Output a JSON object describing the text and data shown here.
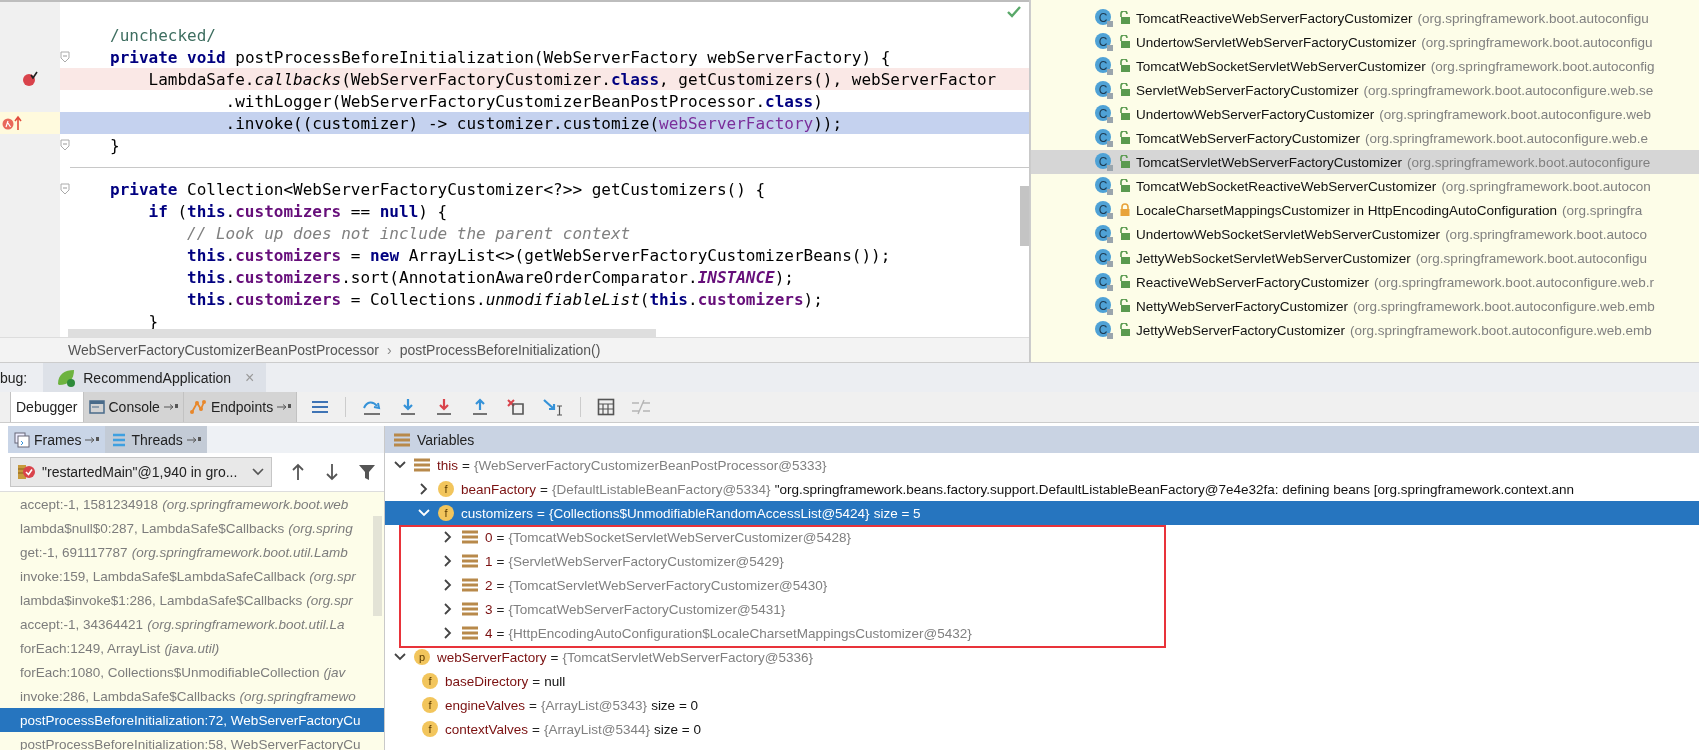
{
  "editor": {
    "lines": [
      {
        "breakpoint": false,
        "execution": false,
        "fold": false,
        "tokens": [
          {
            "kind": "annotation",
            "text": "/unchecked/"
          }
        ]
      },
      {
        "breakpoint": false,
        "execution": false,
        "fold": true,
        "tokens": [
          {
            "kind": "kw",
            "text": "private"
          },
          {
            "kind": "kw",
            "text": " void"
          },
          {
            "kind": "plain",
            "text": " postProcessBeforeInitialization(WebServerFactory webServerFactory) {"
          }
        ]
      },
      {
        "breakpoint": true,
        "execution": false,
        "fold": false,
        "tokens": [
          {
            "kind": "plain",
            "text": "    LambdaSafe."
          },
          {
            "kind": "italic",
            "text": "callbacks"
          },
          {
            "kind": "plain",
            "text": "(WebServerFactoryCustomizer."
          },
          {
            "kind": "kw",
            "text": "class"
          },
          {
            "kind": "plain",
            "text": ", getCustomizers(), webServerFactor"
          }
        ]
      },
      {
        "breakpoint": false,
        "execution": false,
        "fold": false,
        "tokens": [
          {
            "kind": "plain",
            "text": "            .withLogger(WebServerFactoryCustomizerBeanPostProcessor."
          },
          {
            "kind": "kw",
            "text": "class"
          },
          {
            "kind": "plain",
            "text": ")"
          }
        ]
      },
      {
        "breakpoint": false,
        "execution": true,
        "fold": false,
        "tokens": [
          {
            "kind": "plain",
            "text": "            .invoke((customizer) -> customizer.customize("
          },
          {
            "kind": "param",
            "text": "webServerFactory"
          },
          {
            "kind": "plain",
            "text": "));"
          }
        ]
      },
      {
        "breakpoint": false,
        "execution": false,
        "fold": true,
        "tokens": [
          {
            "kind": "plain",
            "text": "}"
          }
        ]
      },
      {
        "kind": "separator"
      },
      {
        "breakpoint": false,
        "execution": false,
        "fold": true,
        "tokens": [
          {
            "kind": "kw",
            "text": "private"
          },
          {
            "kind": "plain",
            "text": " Collection<WebServerFactoryCustomizer<?>> getCustomizers() {"
          }
        ]
      },
      {
        "breakpoint": false,
        "execution": false,
        "fold": false,
        "tokens": [
          {
            "kind": "kw",
            "text": "    if"
          },
          {
            "kind": "plain",
            "text": " ("
          },
          {
            "kind": "kw",
            "text": "this"
          },
          {
            "kind": "plain",
            "text": "."
          },
          {
            "kind": "field",
            "text": "customizers"
          },
          {
            "kind": "plain",
            "text": " == "
          },
          {
            "kind": "kw",
            "text": "null"
          },
          {
            "kind": "plain",
            "text": ") {"
          }
        ]
      },
      {
        "breakpoint": false,
        "execution": false,
        "fold": false,
        "tokens": [
          {
            "kind": "comment",
            "text": "        // Look up does not include the parent context"
          }
        ]
      },
      {
        "breakpoint": false,
        "execution": false,
        "fold": false,
        "tokens": [
          {
            "kind": "kw",
            "text": "        this"
          },
          {
            "kind": "plain",
            "text": "."
          },
          {
            "kind": "field",
            "text": "customizers"
          },
          {
            "kind": "plain",
            "text": " = "
          },
          {
            "kind": "kw",
            "text": "new"
          },
          {
            "kind": "plain",
            "text": " ArrayList<>(getWebServerFactoryCustomizerBeans());"
          }
        ]
      },
      {
        "breakpoint": false,
        "execution": false,
        "fold": false,
        "tokens": [
          {
            "kind": "kw",
            "text": "        this"
          },
          {
            "kind": "plain",
            "text": "."
          },
          {
            "kind": "field",
            "text": "customizers"
          },
          {
            "kind": "plain",
            "text": ".sort(AnnotationAwareOrderComparator."
          },
          {
            "kind": "static",
            "text": "INSTANCE"
          },
          {
            "kind": "plain",
            "text": ");"
          }
        ]
      },
      {
        "breakpoint": false,
        "execution": false,
        "fold": false,
        "tokens": [
          {
            "kind": "kw",
            "text": "        this"
          },
          {
            "kind": "plain",
            "text": "."
          },
          {
            "kind": "field",
            "text": "customizers"
          },
          {
            "kind": "plain",
            "text": " = Collections."
          },
          {
            "kind": "italic",
            "text": "unmodifiableList"
          },
          {
            "kind": "plain",
            "text": "("
          },
          {
            "kind": "kw",
            "text": "this"
          },
          {
            "kind": "plain",
            "text": "."
          },
          {
            "kind": "field",
            "text": "customizers"
          },
          {
            "kind": "plain",
            "text": ");"
          }
        ]
      },
      {
        "breakpoint": false,
        "execution": false,
        "fold": false,
        "tokens": [
          {
            "kind": "plain",
            "text": "    }"
          }
        ]
      }
    ]
  },
  "breadcrumb": {
    "separator": "›",
    "items": [
      "WebServerFactoryCustomizerBeanPostProcessor",
      "postProcessBeforeInitialization()"
    ]
  },
  "implementations": [
    {
      "badge": "C",
      "locked": false,
      "selected": false,
      "name": "TomcatReactiveWebServerFactoryCustomizer",
      "package": "(org.springframework.boot.autoconfigu"
    },
    {
      "badge": "C",
      "locked": false,
      "selected": false,
      "name": "UndertowServletWebServerFactoryCustomizer",
      "package": "(org.springframework.boot.autoconfigu"
    },
    {
      "badge": "C",
      "locked": false,
      "selected": false,
      "name": "TomcatWebSocketServletWebServerCustomizer",
      "package": "(org.springframework.boot.autoconfig"
    },
    {
      "badge": "C",
      "locked": false,
      "selected": false,
      "name": "ServletWebServerFactoryCustomizer",
      "package": "(org.springframework.boot.autoconfigure.web.se"
    },
    {
      "badge": "C",
      "locked": false,
      "selected": false,
      "name": "UndertowWebServerFactoryCustomizer",
      "package": "(org.springframework.boot.autoconfigure.web"
    },
    {
      "badge": "C",
      "locked": false,
      "selected": false,
      "name": "TomcatWebServerFactoryCustomizer",
      "package": "(org.springframework.boot.autoconfigure.web.e"
    },
    {
      "badge": "C",
      "locked": false,
      "selected": true,
      "name": "TomcatServletWebServerFactoryCustomizer",
      "package": "(org.springframework.boot.autoconfigure"
    },
    {
      "badge": "C",
      "locked": false,
      "selected": false,
      "name": "TomcatWebSocketReactiveWebServerCustomizer",
      "package": "(org.springframework.boot.autocon"
    },
    {
      "badge": "C",
      "locked": true,
      "selected": false,
      "name": "LocaleCharsetMappingsCustomizer in HttpEncodingAutoConfiguration",
      "package": "(org.springfra"
    },
    {
      "badge": "C",
      "locked": false,
      "selected": false,
      "name": "UndertowWebSocketServletWebServerCustomizer",
      "package": "(org.springframework.boot.autoco"
    },
    {
      "badge": "C",
      "locked": false,
      "selected": false,
      "name": "JettyWebSocketServletWebServerCustomizer",
      "package": "(org.springframework.boot.autoconfigu"
    },
    {
      "badge": "C",
      "locked": false,
      "selected": false,
      "name": "ReactiveWebServerFactoryCustomizer",
      "package": "(org.springframework.boot.autoconfigure.web.r"
    },
    {
      "badge": "C",
      "locked": false,
      "selected": false,
      "name": "NettyWebServerFactoryCustomizer",
      "package": "(org.springframework.boot.autoconfigure.web.emb"
    },
    {
      "badge": "C",
      "locked": false,
      "selected": false,
      "name": "JettyWebServerFactoryCustomizer",
      "package": "(org.springframework.boot.autoconfigure.web.emb"
    }
  ],
  "debug": {
    "prefix": "bug:",
    "session": {
      "title": "RecommendApplication",
      "close": "×"
    },
    "tabs": [
      {
        "kind": "debugger",
        "label": "Debugger",
        "selected": true,
        "pinned": false
      },
      {
        "kind": "console",
        "label": "Console",
        "selected": false,
        "pinned": true
      },
      {
        "kind": "endpoints",
        "label": "Endpoints",
        "selected": false,
        "pinned": true
      }
    ]
  },
  "frames_panel": {
    "tabs": [
      {
        "kind": "frames",
        "label": "Frames",
        "selected": true
      },
      {
        "kind": "threads",
        "label": "Threads",
        "selected": false
      }
    ],
    "thread": "\"restartedMain\"@1,940 in gro...",
    "frames": [
      {
        "method": "accept:-1, 1581234918",
        "package": "(org.springframework.boot.web",
        "selected": false
      },
      {
        "method": "lambda$null$0:287, LambdaSafe$Callbacks",
        "package": "(org.spring",
        "selected": false
      },
      {
        "method": "get:-1, 691117787",
        "package": "(org.springframework.boot.util.Lamb",
        "selected": false
      },
      {
        "method": "invoke:159, LambdaSafe$LambdaSafeCallback",
        "package": "(org.spr",
        "selected": false
      },
      {
        "method": "lambda$invoke$1:286, LambdaSafe$Callbacks",
        "package": "(org.spr",
        "selected": false
      },
      {
        "method": "accept:-1, 34364421",
        "package": "(org.springframework.boot.util.La",
        "selected": false
      },
      {
        "method": "forEach:1249, ArrayList",
        "package": "(java.util)",
        "selected": false
      },
      {
        "method": "forEach:1080, Collections$UnmodifiableCollection",
        "package": "(jav",
        "selected": false
      },
      {
        "method": "invoke:286, LambdaSafe$Callbacks",
        "package": "(org.springframewo",
        "selected": false
      },
      {
        "method": "postProcessBeforeInitialization:72, WebServerFactoryCu",
        "selected": true
      },
      {
        "method": "postProcessBeforeInitialization:58, WebServerFactoryCu",
        "selected": false
      }
    ]
  },
  "variables": {
    "title": "Variables",
    "tree": [
      {
        "kind": "object",
        "name": "this",
        "op": "=",
        "value": "{WebServerFactoryCustomizerBeanPostProcessor@5333}",
        "literal": false,
        "expanded": true,
        "selected": false,
        "children": [
          {
            "kind": "field",
            "badge": "f",
            "name": "beanFactory",
            "op": "=",
            "value": "{DefaultListableBeanFactory@5334}",
            "extra": "\"org.springframework.beans.factory.support.DefaultListableBeanFactory@7e4e32fa: defining beans [org.springframework.context.ann",
            "literal": false,
            "expanded": false,
            "selected": false
          },
          {
            "kind": "field",
            "badge": "f",
            "name": "customizers",
            "op": "=",
            "value": "{Collections$UnmodifiableRandomAccessList@5424}",
            "extra": "size = 5",
            "literal": false,
            "expanded": true,
            "selected": true,
            "highlighted": true,
            "children": [
              {
                "kind": "object",
                "name": "0",
                "op": "=",
                "value": "{TomcatWebSocketServletWebServerCustomizer@5428}",
                "literal": false,
                "expanded": false,
                "selected": false
              },
              {
                "kind": "object",
                "name": "1",
                "op": "=",
                "value": "{ServletWebServerFactoryCustomizer@5429}",
                "literal": false,
                "expanded": false,
                "selected": false
              },
              {
                "kind": "object",
                "name": "2",
                "op": "=",
                "value": "{TomcatServletWebServerFactoryCustomizer@5430}",
                "literal": false,
                "expanded": false,
                "selected": false
              },
              {
                "kind": "object",
                "name": "3",
                "op": "=",
                "value": "{TomcatWebServerFactoryCustomizer@5431}",
                "literal": false,
                "expanded": false,
                "selected": false
              },
              {
                "kind": "object",
                "name": "4",
                "op": "=",
                "value": "{HttpEncodingAutoConfiguration$LocaleCharsetMappingsCustomizer@5432}",
                "literal": false,
                "expanded": false,
                "selected": false
              }
            ]
          }
        ]
      },
      {
        "kind": "param",
        "badge": "p",
        "name": "webServerFactory",
        "op": "=",
        "value": "{TomcatServletWebServerFactory@5336}",
        "literal": false,
        "expanded": true,
        "selected": false,
        "children": [
          {
            "kind": "field",
            "badge": "f",
            "name": "baseDirectory",
            "op": "=",
            "value": "null",
            "literal": true,
            "selected": false
          },
          {
            "kind": "field",
            "badge": "f",
            "name": "engineValves",
            "op": "=",
            "value": "{ArrayList@5343}",
            "extra": "size = 0",
            "literal": false,
            "selected": false
          },
          {
            "kind": "field",
            "badge": "f",
            "name": "contextValves",
            "op": "=",
            "value": "{ArrayList@5344}",
            "extra": "size = 0",
            "literal": false,
            "selected": false
          }
        ]
      }
    ]
  }
}
